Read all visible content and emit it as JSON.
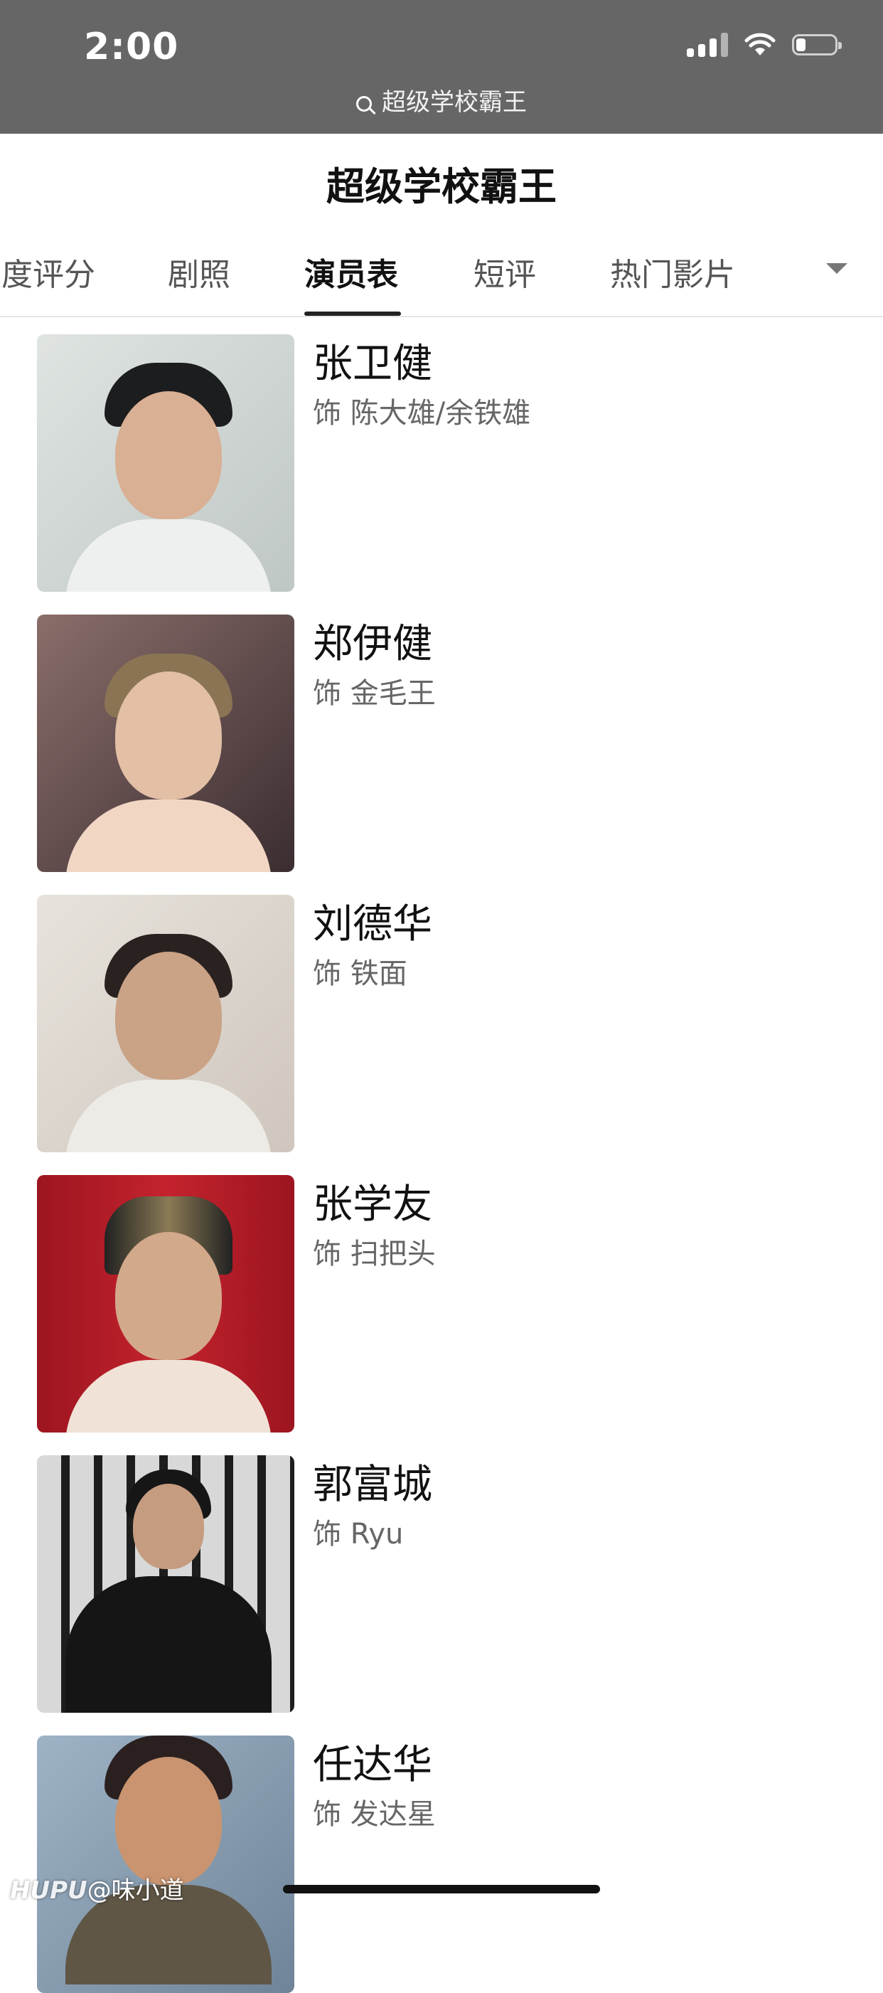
{
  "status_bar": {
    "time": "2:00",
    "battery_level": 0.25
  },
  "search": {
    "query": "超级学校霸王"
  },
  "page": {
    "title": "超级学校霸王"
  },
  "tabs": [
    {
      "label": "度评分",
      "active": false
    },
    {
      "label": "剧照",
      "active": false
    },
    {
      "label": "演员表",
      "active": true
    },
    {
      "label": "短评",
      "active": false
    },
    {
      "label": "热门影片",
      "active": false
    }
  ],
  "cast": [
    {
      "name": "张卫健",
      "role": "饰 陈大雄/余铁雄"
    },
    {
      "name": "郑伊健",
      "role": "饰 金毛王"
    },
    {
      "name": "刘德华",
      "role": "饰 铁面"
    },
    {
      "name": "张学友",
      "role": "饰 扫把头"
    },
    {
      "name": "郭富城",
      "role": "饰 Ryu"
    },
    {
      "name": "任达华",
      "role": "饰 发达星"
    }
  ],
  "watermark": {
    "brand": "HUPU",
    "handle": "@味小道"
  }
}
